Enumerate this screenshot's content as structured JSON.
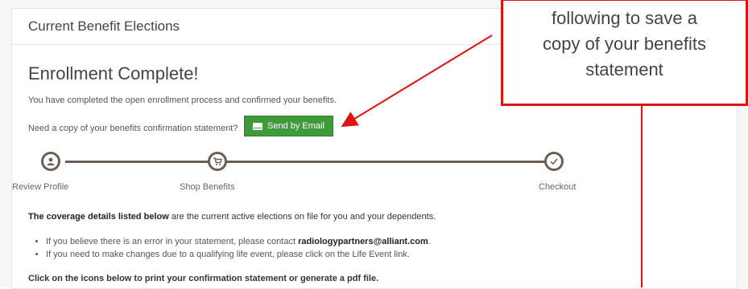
{
  "panel": {
    "title": "Current Benefit Elections",
    "heading": "Enrollment Complete!",
    "completed_text": "You have completed the open enrollment process and confirmed your benefits.",
    "confirmation_question": "Need a copy of your benefits confirmation statement?",
    "send_email_label": "Send by Email",
    "steps": [
      {
        "label": "Review Profile",
        "icon": "user-icon"
      },
      {
        "label": "Shop Benefits",
        "icon": "cart-icon"
      },
      {
        "label": "Checkout",
        "icon": "check-icon"
      }
    ],
    "coverage_bold": "The coverage details listed below",
    "coverage_rest": " are the current active elections on file for you and your dependents.",
    "bullets": [
      {
        "text": "If you believe there is an error in your statement, please contact ",
        "email": "radiologypartners@alliant.com",
        "tail": "."
      },
      {
        "text": "If you need to make changes due to a qualifying life event, please click on the Life Event link.",
        "email": "",
        "tail": ""
      }
    ],
    "print_instructions": "Click on the icons below to print your confirmation statement or generate a pdf file."
  },
  "callout": {
    "text": "following to save a\ncopy of your benefits\nstatement",
    "border_color": "#e31212"
  },
  "colors": {
    "button_green": "#3f9a3a",
    "stepper": "#6b5e57",
    "arrow_red": "#e31212"
  }
}
